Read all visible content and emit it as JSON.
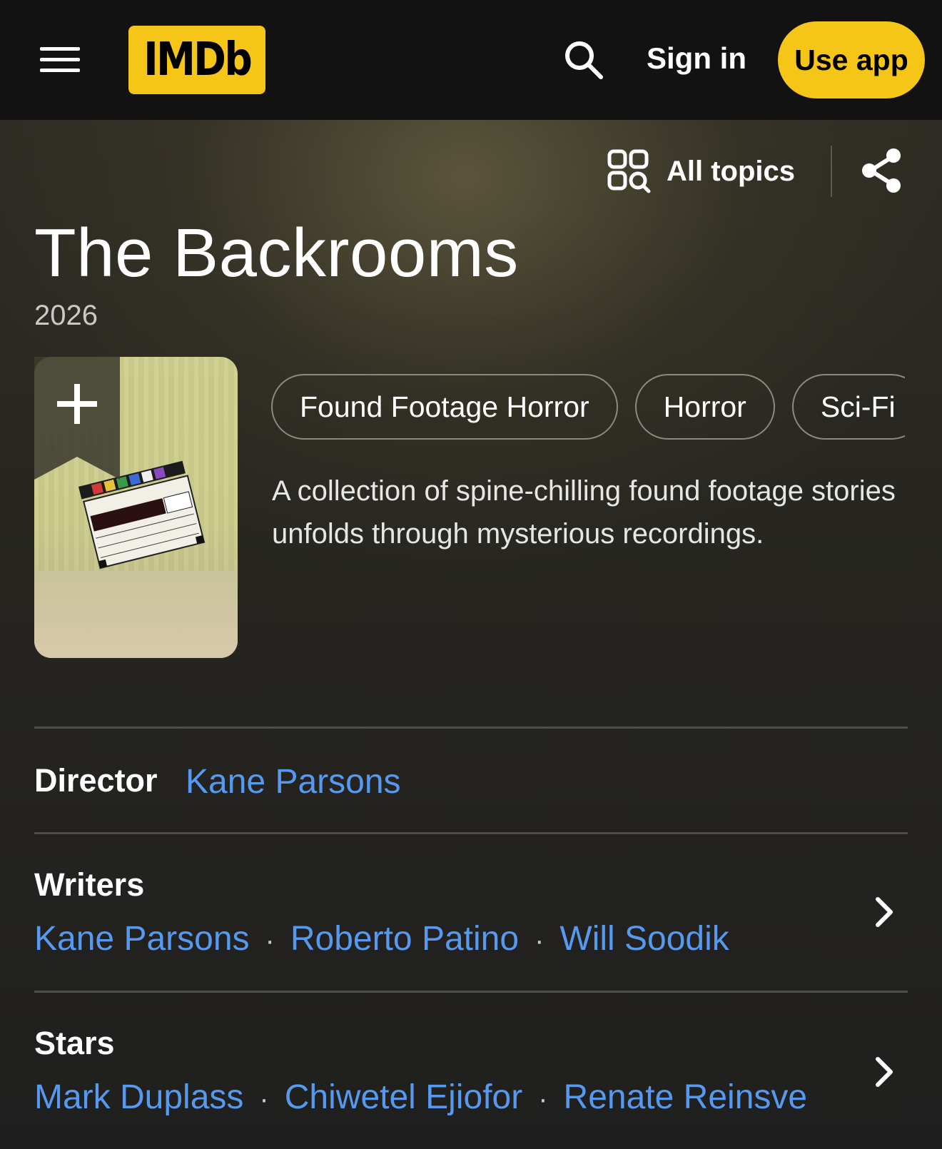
{
  "header": {
    "logo_text": "IMDb",
    "sign_in_label": "Sign in",
    "use_app_label": "Use app",
    "accent_color": "#f5c518"
  },
  "toolbar": {
    "all_topics_label": "All topics"
  },
  "title": {
    "name": "The Backrooms",
    "year": "2026"
  },
  "genres": [
    "Found Footage Horror",
    "Horror",
    "Sci-Fi"
  ],
  "plot": "A collection of spine-chilling found footage stories unfolds through mysterious recordings.",
  "credits": {
    "director": {
      "label": "Director",
      "names": [
        "Kane Parsons"
      ]
    },
    "writers": {
      "label": "Writers",
      "names": [
        "Kane Parsons",
        "Roberto Patino",
        "Will Soodik"
      ]
    },
    "stars": {
      "label": "Stars",
      "names": [
        "Mark Duplass",
        "Chiwetel Ejiofor",
        "Renate Reinsve"
      ]
    },
    "separator": "·",
    "link_color": "#5799ef"
  },
  "icons": {
    "menu": "hamburger-menu-icon",
    "search": "search-icon",
    "topics": "topics-grid-search-icon",
    "share": "share-icon",
    "watchlist": "add-to-watchlist-icon",
    "chevron": "chevron-right-icon"
  }
}
